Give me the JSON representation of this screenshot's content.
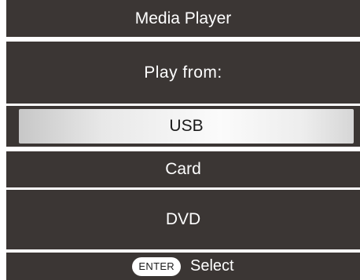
{
  "header": {
    "title": "Media Player"
  },
  "prompt": {
    "text": "Play from:"
  },
  "menu": {
    "items": [
      {
        "label": "USB",
        "selected": true
      },
      {
        "label": "Card",
        "selected": false
      },
      {
        "label": "DVD",
        "selected": false
      }
    ]
  },
  "footer": {
    "key_label": "ENTER",
    "action_label": "Select"
  },
  "colors": {
    "panel_background": "#3b3634",
    "separator": "#ffffff",
    "text": "#ffffff",
    "selected_text": "#1a1a1a"
  }
}
